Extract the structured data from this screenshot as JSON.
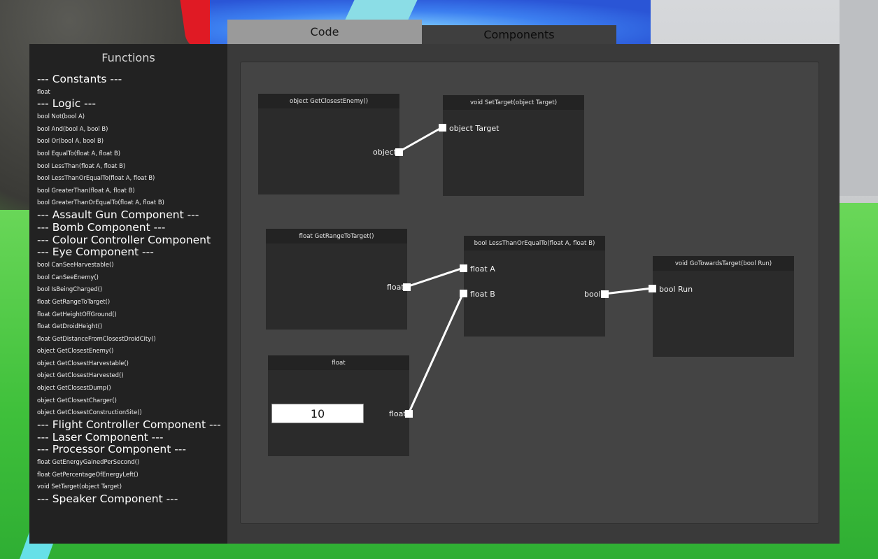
{
  "tabs": {
    "code_label": "Code",
    "components_label": "Components"
  },
  "functions": {
    "title": "Functions",
    "sections": [
      {
        "header": "--- Constants ---",
        "items": [
          "float"
        ]
      },
      {
        "header": "--- Logic ---",
        "items": [
          "bool Not(bool A)",
          "bool And(bool A, bool B)",
          "bool Or(bool A, bool B)",
          "bool EqualTo(float A, float B)",
          "bool LessThan(float A, float B)",
          "bool LessThanOrEqualTo(float A, float B)",
          "bool GreaterThan(float A, float B)",
          "bool GreaterThanOrEqualTo(float A, float B)"
        ]
      },
      {
        "header": "--- Assault Gun Component ---",
        "items": []
      },
      {
        "header": "--- Bomb Component ---",
        "items": []
      },
      {
        "header": "--- Colour Controller Component",
        "items": []
      },
      {
        "header": "--- Eye Component ---",
        "items": [
          "bool CanSeeHarvestable()",
          "bool CanSeeEnemy()",
          "bool IsBeingCharged()",
          "float GetRangeToTarget()",
          "float GetHeightOffGround()",
          "float GetDroidHeight()",
          "float GetDistanceFromClosestDroidCity()",
          "object GetClosestEnemy()",
          "object GetClosestHarvestable()",
          "object GetClosestHarvested()",
          "object GetClosestDump()",
          "object GetClosestCharger()",
          "object GetClosestConstructionSite()"
        ]
      },
      {
        "header": "--- Flight Controller Component ---",
        "items": []
      },
      {
        "header": "--- Laser Component ---",
        "items": []
      },
      {
        "header": "--- Processor Component ---",
        "items": [
          "float GetEnergyGainedPerSecond()",
          "float GetPercentageOfEnergyLeft()",
          "void SetTarget(object Target)"
        ]
      },
      {
        "header": "--- Speaker Component ---",
        "items": []
      }
    ]
  },
  "nodes": {
    "get_closest_enemy": {
      "title": "object GetClosestEnemy()",
      "output": "object"
    },
    "set_target": {
      "title": "void SetTarget(object Target)",
      "input": "object Target"
    },
    "get_range_to_target": {
      "title": "float GetRangeToTarget()",
      "output": "float"
    },
    "less_than_or_equal": {
      "title": "bool LessThanOrEqualTo(float A, float B)",
      "input_a": "float A",
      "input_b": "float B",
      "output": "bool"
    },
    "go_towards_target": {
      "title": "void GoTowardsTarget(bool Run)",
      "input": "bool Run"
    },
    "float_constant": {
      "title": "float",
      "value": "10",
      "output": "float"
    }
  },
  "colors": {
    "panel": "#222222",
    "canvas": "#444444",
    "node": "#2b2b2b",
    "wire": "#ffffff"
  }
}
